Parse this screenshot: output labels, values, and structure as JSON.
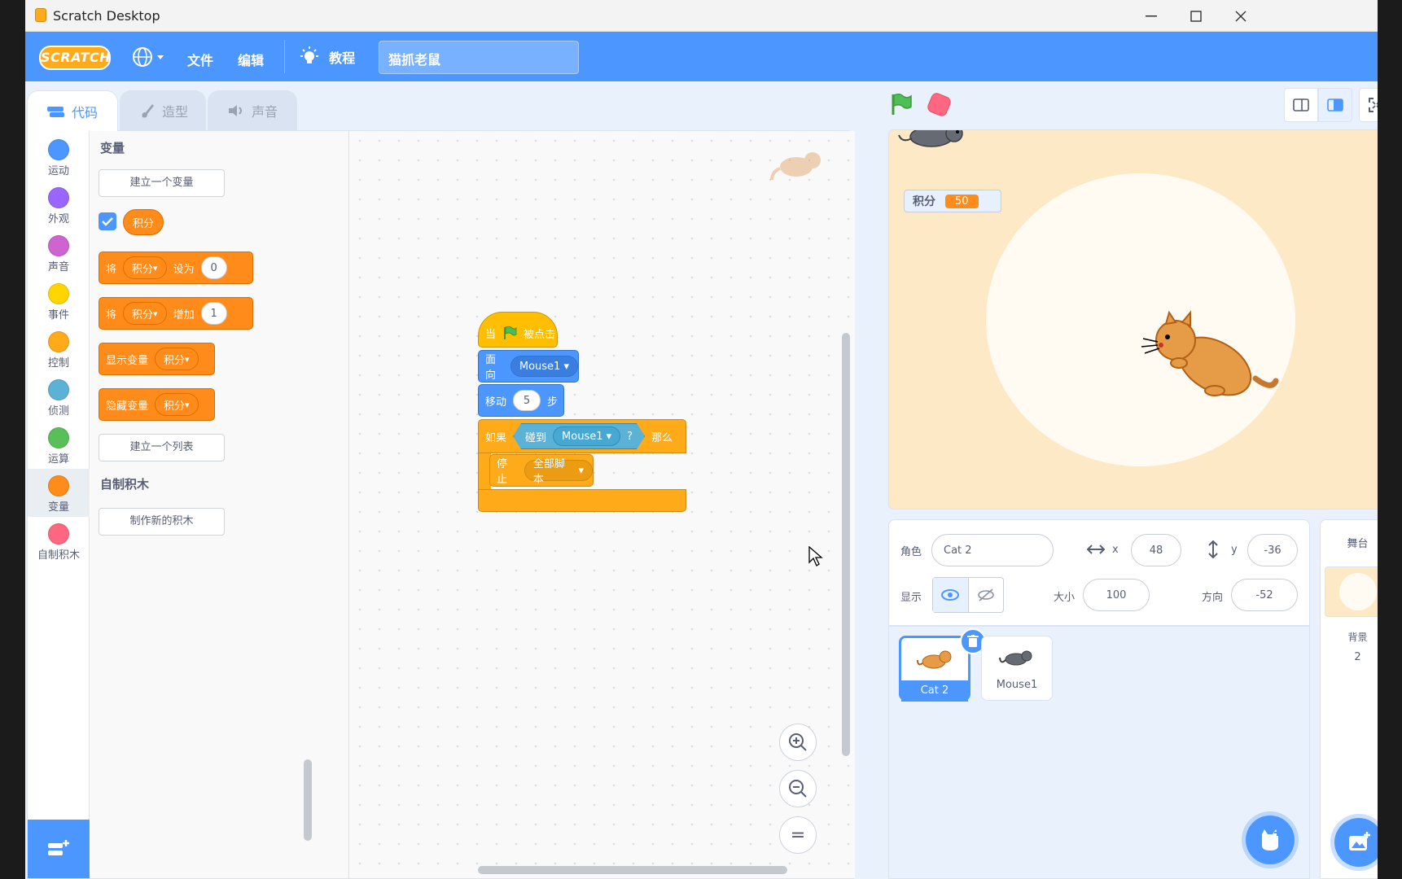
{
  "window": {
    "title": "Scratch Desktop"
  },
  "menubar": {
    "logo": "SCRATCH",
    "file": "文件",
    "edit": "编辑",
    "tutorials": "教程",
    "project_title": "猫抓老鼠"
  },
  "tabs": {
    "code": "代码",
    "costumes": "造型",
    "sounds": "声音"
  },
  "categories": [
    {
      "label": "运动",
      "color": "#4c97ff"
    },
    {
      "label": "外观",
      "color": "#9966ff"
    },
    {
      "label": "声音",
      "color": "#cf63cf"
    },
    {
      "label": "事件",
      "color": "#ffd500"
    },
    {
      "label": "控制",
      "color": "#ffab19"
    },
    {
      "label": "侦测",
      "color": "#5cb1d6"
    },
    {
      "label": "运算",
      "color": "#59c059"
    },
    {
      "label": "变量",
      "color": "#ff8c1a"
    },
    {
      "label": "自制积木",
      "color": "#ff6680"
    }
  ],
  "palette": {
    "variables_heading": "变量",
    "make_variable": "建立一个变量",
    "variable_name": "积分",
    "set_block": {
      "prefix": "将",
      "var": "积分",
      "verb": "设为",
      "value": "0"
    },
    "change_block": {
      "prefix": "将",
      "var": "积分",
      "verb": "增加",
      "value": "1"
    },
    "show_block": {
      "label": "显示变量",
      "var": "积分"
    },
    "hide_block": {
      "label": "隐藏变量",
      "var": "积分"
    },
    "make_list": "建立一个列表",
    "my_blocks_heading": "自制积木",
    "make_block": "制作新的积木"
  },
  "script": {
    "hat": {
      "when": "当",
      "clicked": "被点击"
    },
    "point": {
      "label": "面向",
      "target": "Mouse1"
    },
    "move": {
      "label": "移动",
      "steps": "5",
      "unit": "步"
    },
    "if": {
      "label": "如果",
      "then": "那么"
    },
    "touching": {
      "label": "碰到",
      "target": "Mouse1",
      "q": "?"
    },
    "stop": {
      "label": "停止",
      "option": "全部脚本"
    }
  },
  "stage": {
    "monitor_label": "积分",
    "monitor_value": "50"
  },
  "sprite_info": {
    "sprite_label": "角色",
    "sprite_name": "Cat 2",
    "x_label": "x",
    "x_value": "48",
    "y_label": "y",
    "y_value": "-36",
    "show_label": "显示",
    "size_label": "大小",
    "size_value": "100",
    "direction_label": "方向",
    "direction_value": "-52"
  },
  "sprites": [
    {
      "name": "Cat 2"
    },
    {
      "name": "Mouse1"
    }
  ],
  "stage_pane": {
    "title": "舞台",
    "backdrops_label": "背景",
    "backdrops_count": "2"
  },
  "zoom": {
    "in": "+",
    "out": "−",
    "reset": "="
  },
  "colors": {
    "menu_blue": "#4c97ff",
    "variables_orange": "#ff8c1a",
    "events_yellow": "#ffbf00",
    "control_orange": "#ffab19",
    "sensing_cyan": "#5cb1d6",
    "stage_backdrop": "#fde9c6"
  }
}
